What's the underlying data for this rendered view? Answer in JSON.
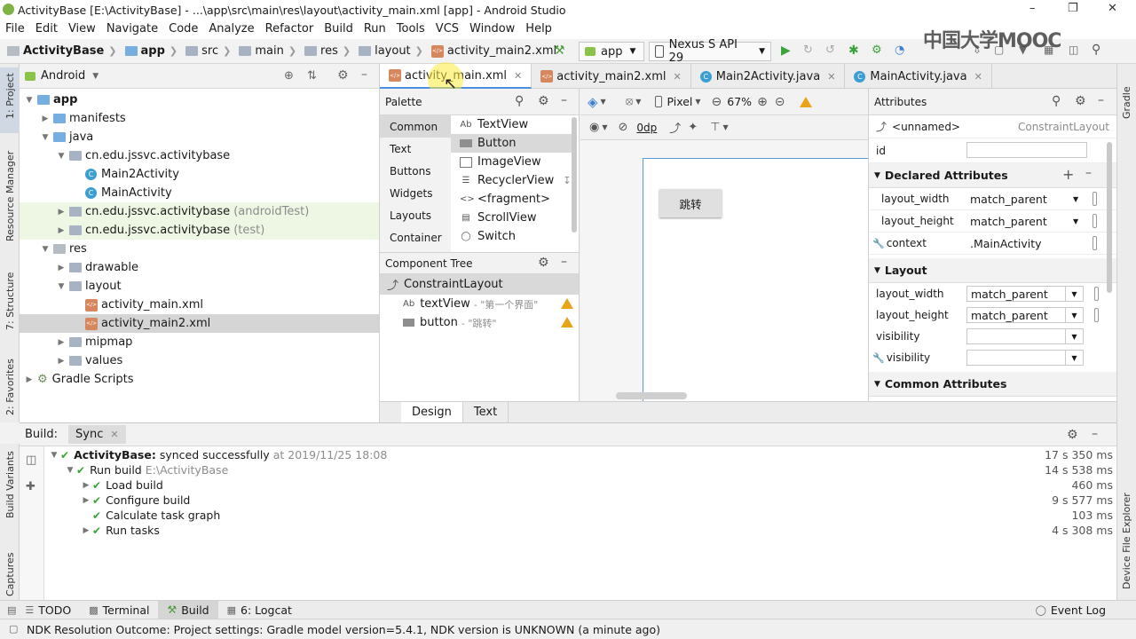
{
  "window": {
    "title": "ActivityBase [E:\\ActivityBase] - ...\\app\\src\\main\\res\\layout\\activity_main.xml [app] - Android Studio"
  },
  "menu": [
    "File",
    "Edit",
    "View",
    "Navigate",
    "Code",
    "Analyze",
    "Refactor",
    "Build",
    "Run",
    "Tools",
    "VCS",
    "Window",
    "Help"
  ],
  "breadcrumbs": [
    "ActivityBase",
    "app",
    "src",
    "main",
    "res",
    "layout",
    "activity_main2.xml"
  ],
  "toolbar": {
    "run_config": "app",
    "device": "Nexus S API 29"
  },
  "watermark": "中国大学MOOC",
  "project": {
    "view_mode": "Android",
    "tree": [
      {
        "label": "app",
        "depth": 0,
        "kind": "folder-blue",
        "expanded": true
      },
      {
        "label": "manifests",
        "depth": 1,
        "kind": "folder-blue",
        "expanded": false
      },
      {
        "label": "java",
        "depth": 1,
        "kind": "folder-blue",
        "expanded": true
      },
      {
        "label": "cn.edu.jssvc.activitybase",
        "depth": 2,
        "kind": "folder",
        "expanded": true
      },
      {
        "label": "Main2Activity",
        "depth": 3,
        "kind": "class"
      },
      {
        "label": "MainActivity",
        "depth": 3,
        "kind": "class"
      },
      {
        "label": "cn.edu.jssvc.activitybase",
        "suffix": "(androidTest)",
        "depth": 2,
        "kind": "folder",
        "expanded": false,
        "test": true
      },
      {
        "label": "cn.edu.jssvc.activitybase",
        "suffix": "(test)",
        "depth": 2,
        "kind": "folder",
        "expanded": false,
        "test": true
      },
      {
        "label": "res",
        "depth": 1,
        "kind": "folder-gray",
        "expanded": true
      },
      {
        "label": "drawable",
        "depth": 2,
        "kind": "folder",
        "expanded": false
      },
      {
        "label": "layout",
        "depth": 2,
        "kind": "folder",
        "expanded": true
      },
      {
        "label": "activity_main.xml",
        "depth": 3,
        "kind": "xml"
      },
      {
        "label": "activity_main2.xml",
        "depth": 3,
        "kind": "xml",
        "selected": true
      },
      {
        "label": "mipmap",
        "depth": 2,
        "kind": "folder",
        "expanded": false
      },
      {
        "label": "values",
        "depth": 2,
        "kind": "folder",
        "expanded": false
      },
      {
        "label": "Gradle Scripts",
        "depth": 0,
        "kind": "gradle",
        "expanded": false
      }
    ]
  },
  "editor_tabs": [
    {
      "label": "activity_main.xml",
      "kind": "xml",
      "active": true
    },
    {
      "label": "activity_main2.xml",
      "kind": "xml"
    },
    {
      "label": "Main2Activity.java",
      "kind": "class"
    },
    {
      "label": "MainActivity.java",
      "kind": "class"
    }
  ],
  "palette": {
    "title": "Palette",
    "categories": [
      "Common",
      "Text",
      "Buttons",
      "Widgets",
      "Layouts",
      "Container"
    ],
    "items": [
      {
        "label": "TextView",
        "icon": "Ab"
      },
      {
        "label": "Button",
        "icon": "btn",
        "selected": true
      },
      {
        "label": "ImageView",
        "icon": "img"
      },
      {
        "label": "RecyclerView",
        "icon": "list"
      },
      {
        "label": "<fragment>",
        "icon": "<>"
      },
      {
        "label": "ScrollView",
        "icon": "scroll"
      },
      {
        "label": "Switch",
        "icon": "switch"
      }
    ]
  },
  "component_tree": {
    "title": "Component Tree",
    "root": "ConstraintLayout",
    "children": [
      {
        "name": "textView",
        "text": "\"第一个界面\"",
        "icon": "Ab"
      },
      {
        "name": "button",
        "text": "\"跳转\"",
        "icon": "btn"
      }
    ]
  },
  "design_toolbar": {
    "device": "Pixel",
    "zoom": "67%",
    "margin": "0dp"
  },
  "preview": {
    "button_text": "跳转"
  },
  "attributes": {
    "title": "Attributes",
    "component": "<unnamed>",
    "component_type": "ConstraintLayout",
    "id_label": "id",
    "declared_title": "Declared Attributes",
    "declared": [
      {
        "key": "layout_width",
        "value": "match_parent"
      },
      {
        "key": "layout_height",
        "value": "match_parent"
      },
      {
        "key": "context",
        "value": ".MainActivity"
      }
    ],
    "layout_title": "Layout",
    "layout": [
      {
        "key": "layout_width",
        "value": "match_parent"
      },
      {
        "key": "layout_height",
        "value": "match_parent"
      },
      {
        "key": "visibility",
        "value": ""
      },
      {
        "key": "visibility",
        "value": ""
      }
    ],
    "common_title": "Common Attributes"
  },
  "design_tabs": [
    "Design",
    "Text"
  ],
  "build": {
    "tabs": [
      "Build:",
      "Sync"
    ],
    "rows": [
      {
        "depth": 0,
        "bold": "ActivityBase:",
        "text": "synced successfully",
        "muted": "at 2019/11/25 18:08",
        "time": "17 s 350 ms",
        "expander": true
      },
      {
        "depth": 1,
        "text": "Run build",
        "muted": "E:\\ActivityBase",
        "time": "14 s 538 ms",
        "expander": true
      },
      {
        "depth": 2,
        "text": "Load build",
        "time": "460 ms",
        "expander": true
      },
      {
        "depth": 2,
        "text": "Configure build",
        "time": "9 s 577 ms",
        "expander": true
      },
      {
        "depth": 2,
        "text": "Calculate task graph",
        "time": "103 ms",
        "expander": false
      },
      {
        "depth": 2,
        "text": "Run tasks",
        "time": "4 s 308 ms",
        "expander": true
      }
    ]
  },
  "side_tools_left": [
    "1: Project",
    "Resource Manager",
    "7: Structure",
    "2: Favorites",
    "Build Variants",
    "Captures"
  ],
  "side_tools_right": [
    "Gradle",
    "Device File Explorer"
  ],
  "bottom_tools": [
    "TODO",
    "Terminal",
    "Build",
    "6: Logcat"
  ],
  "event_log": "Event Log",
  "status": "NDK Resolution Outcome: Project settings: Gradle model version=5.4.1, NDK version is UNKNOWN (a minute ago)"
}
